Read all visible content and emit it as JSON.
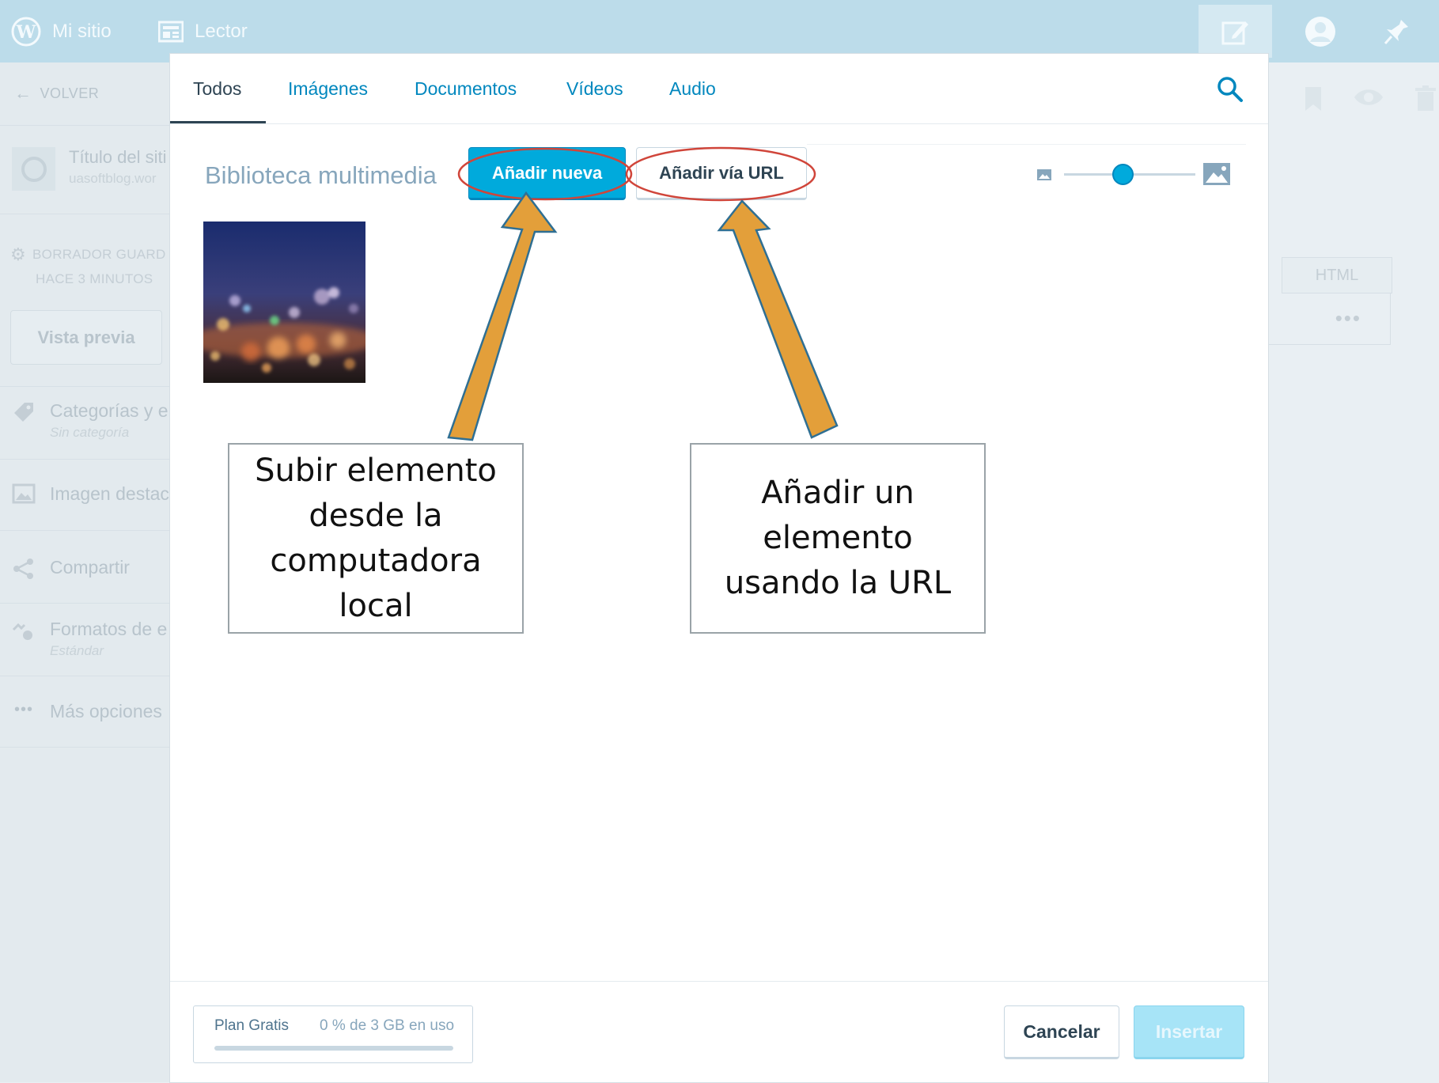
{
  "masterbar": {
    "my_site": "Mi sitio",
    "reader": "Lector",
    "icons": [
      "wordpress-logo-icon",
      "reader-icon",
      "write-icon",
      "avatar-icon",
      "notifications-icon"
    ]
  },
  "sidebar": {
    "back_label": "VOLVER",
    "site_title": "Título del siti",
    "site_url": "uasoftblog.wor",
    "draft_status_line1": "BORRADOR GUARD",
    "draft_status_line2": "HACE 3 MINUTOS",
    "preview_button": "Vista previa",
    "rows": [
      {
        "label": "Categorías y e",
        "sub": "Sin categoría",
        "icon": "tag-icon"
      },
      {
        "label": "Imagen destac",
        "sub": "",
        "icon": "image-icon"
      },
      {
        "label": "Compartir",
        "sub": "",
        "icon": "share-icon"
      },
      {
        "label": "Formatos de e",
        "sub": "Estándar",
        "icon": "post-format-icon"
      },
      {
        "label": "Más opciones",
        "sub": "",
        "icon": "ellipsis-icon"
      }
    ]
  },
  "editor_bg": {
    "html_tab": "HTML",
    "more": "•••"
  },
  "modal": {
    "tabs": [
      "Todos",
      "Imágenes",
      "Documentos",
      "Vídeos",
      "Audio"
    ],
    "active_tab": "Todos",
    "library_title": "Biblioteca multimedia",
    "add_new_button": "Añadir nueva",
    "add_url_button": "Añadir vía URL",
    "zoom_level": 0.45,
    "plan_name": "Plan Gratis",
    "plan_usage": "0 % de 3 GB en uso",
    "plan_usage_fraction": 0.0,
    "cancel_button": "Cancelar",
    "insert_button": "Insertar"
  },
  "annotations": {
    "left_callout": "Subir elemento\ndesde la\ncomputadora\nlocal",
    "right_callout": "Añadir un\nelemento\nusando la URL",
    "arrow_color": "#e39f3a",
    "ellipse_color": "#d0453a"
  },
  "colors": {
    "accent": "#00aadc",
    "masterbar": "#bcdcea",
    "link": "#0087be"
  }
}
